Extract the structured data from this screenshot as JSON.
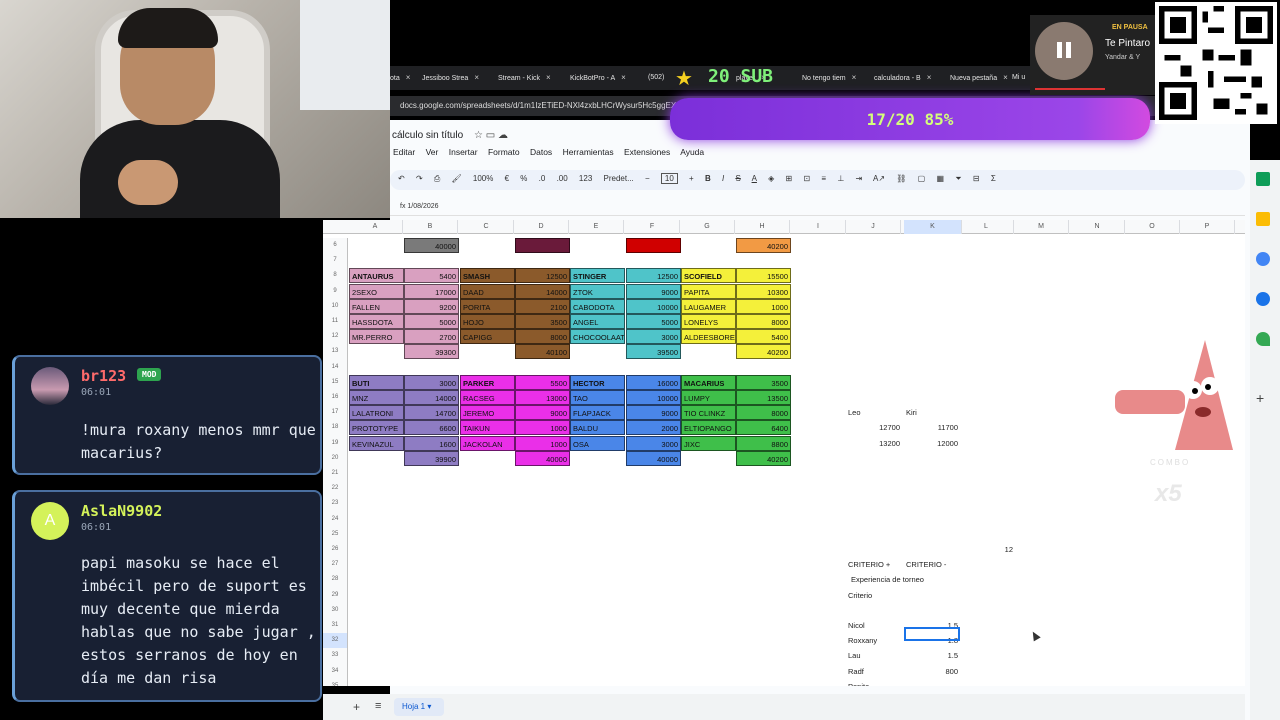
{
  "browser": {
    "tabs": [
      "ota",
      "Jessiboo Strea",
      "Stream - Kick",
      "KickBotPro - A",
      "(502)",
      "player",
      "No tengo tiem",
      "calculadora - B",
      "Nueva pestaña",
      "Mi u"
    ],
    "url": "docs.google.com/spreadsheets/d/1m1IzETiED-NXl4zxbLHCrWysur5Hc5ggEXGBfePo7M"
  },
  "overlay": {
    "sub_label": "20 SUB",
    "goal": "17/20  85%",
    "goal_fraction": 0.85,
    "combo_label": "COMBO",
    "combo_mult": "x5"
  },
  "music": {
    "status": "EN PAUSA",
    "title": "Te Pintaro",
    "artist": "Yandar & Y"
  },
  "sheets": {
    "title": "cálculo sin título",
    "menu": [
      "Editar",
      "Ver",
      "Insertar",
      "Formato",
      "Datos",
      "Herramientas",
      "Extensiones",
      "Ayuda"
    ],
    "toolbar": {
      "zoom": "100%",
      "currency": "€",
      "percent": "%",
      "decimals": "123",
      "font": "Predet...",
      "font_size": "10"
    },
    "formula": "1/08/2026",
    "columns": [
      "A",
      "B",
      "C",
      "D",
      "E",
      "F",
      "G",
      "H",
      "I",
      "J",
      "K",
      "L",
      "M",
      "N",
      "O",
      "P"
    ],
    "rows": [
      "6",
      "7",
      "8",
      "9",
      "10",
      "11",
      "12",
      "13",
      "14",
      "15",
      "16",
      "17",
      "18",
      "19",
      "20",
      "21",
      "22",
      "23",
      "24",
      "25",
      "26",
      "27",
      "28",
      "29",
      "30",
      "31",
      "32",
      "33",
      "34",
      "35"
    ],
    "sheet_tab": "Hoja 1",
    "row6": [
      "40000",
      "40200"
    ],
    "team1": {
      "headers": [
        "ANTAURUS",
        "SMASH",
        "STINGER",
        "SCOFIELD"
      ],
      "header_values": [
        "5400",
        "12500",
        "12500",
        "15500"
      ],
      "players": [
        [
          "2SEXO",
          "17000",
          "DAAD",
          "14000",
          "ZTOK",
          "9000",
          "PAPITA",
          "10300"
        ],
        [
          "FALLEN",
          "9200",
          "PORITA",
          "2100",
          "CABODOTA",
          "10000",
          "LAUGAMER",
          "1000"
        ],
        [
          "HASSDOTA",
          "5000",
          "HOJO",
          "3500",
          "ANGEL",
          "5000",
          "LONELYS",
          "8000"
        ],
        [
          "MR.PERRO",
          "2700",
          "CAPIGG",
          "8000",
          "CHOCOOLAATI",
          "3000",
          "ALDEESBORED",
          "5400"
        ]
      ],
      "totals": [
        "39300",
        "40100",
        "39500",
        "40200"
      ]
    },
    "team2": {
      "headers": [
        "BUTI",
        "PARKER",
        "HECTOR",
        "MACARIUS"
      ],
      "header_values": [
        "3000",
        "5500",
        "16000",
        "3500"
      ],
      "players": [
        [
          "MNZ",
          "14000",
          "RACSEG",
          "13000",
          "TAO",
          "10000",
          "LUMPY",
          "13500"
        ],
        [
          "LALATRONI",
          "14700",
          "JEREMO",
          "9000",
          "FLAPJACK",
          "9000",
          "TIO CLINKZ",
          "8000"
        ],
        [
          "PROTOTYPE",
          "6600",
          "TAIKUN",
          "1000",
          "BALDU",
          "2000",
          "ELTIOPANGO",
          "6400"
        ],
        [
          "KEVINAZUL",
          "1600",
          "JACKOLAN",
          "1000",
          "OSA",
          "3000",
          "JIXC",
          "8800"
        ]
      ],
      "totals": [
        "39900",
        "40000",
        "40000",
        "40200"
      ]
    },
    "side": {
      "leo_label": "Leo",
      "kiri_label": "Kiri",
      "leo_vals": [
        "12700",
        "13200"
      ],
      "kiri_vals": [
        "11700",
        "12000"
      ],
      "l26": "12",
      "crit_plus": "CRITERIO +",
      "crit_minus": "CRITERIO -",
      "exp": "Experiencia de torneo",
      "criterio": "Criterio",
      "names": [
        "Nicol",
        "Roxxany",
        "Lau",
        "Radf",
        "Pepita"
      ],
      "scores": [
        "1.5",
        "1.8",
        "1.5",
        "800",
        ""
      ]
    }
  },
  "chat": [
    {
      "user": "br123",
      "badge": "MOD",
      "time": "06:01",
      "text": "!mura roxany menos mmr que\nmacarius?",
      "color": "#ff6b6b"
    },
    {
      "user": "AslaN9902",
      "initial": "A",
      "time": "06:01",
      "text": "papi masoku se hace el\nimbécil pero de suport es\nmuy decente que mierda\nhablas que no sabe jugar ,\nestos serranos de hoy en\ndía me dan risa",
      "color": "#d4f25a"
    }
  ],
  "colors": {
    "antaurus": "#d9a0c0",
    "smash": "#8b5a2b",
    "stinger": "#4fc4c9",
    "scofield": "#f4f03a",
    "buti": "#8e7cc3",
    "parker": "#ea2fe8",
    "hector": "#4a86e8",
    "macarius": "#3fbf4a"
  }
}
